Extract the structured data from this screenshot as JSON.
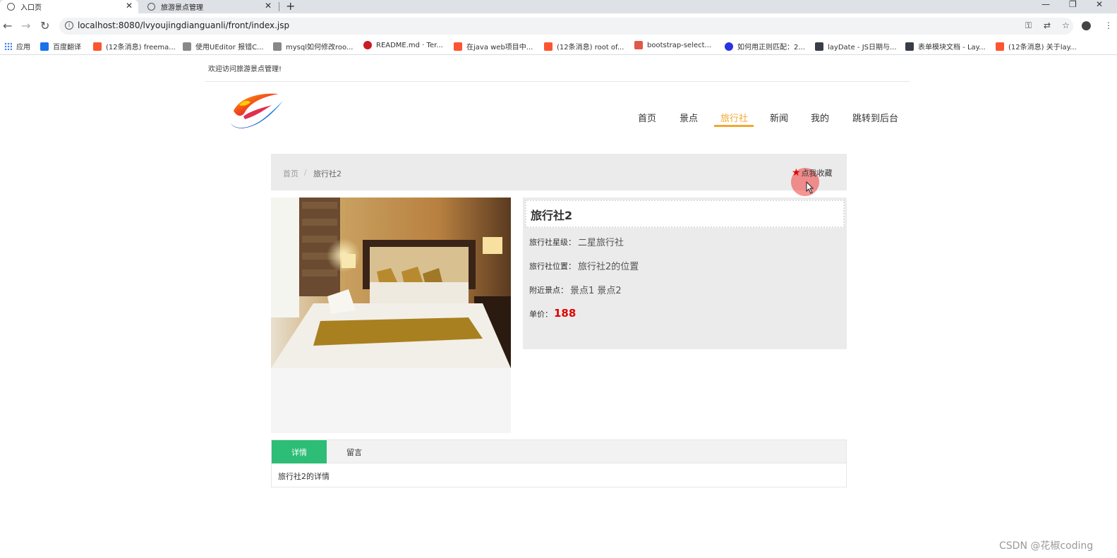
{
  "browser": {
    "tabs": [
      {
        "title": "入口页",
        "active": true
      },
      {
        "title": "旅游景点管理",
        "active": false
      }
    ],
    "url": "localhost:8080/lvyoujingdianguanli/front/index.jsp",
    "bookmarks": [
      {
        "label": "应用",
        "color": "#4285f4"
      },
      {
        "label": "百度翻译",
        "color": "#1a73e8"
      },
      {
        "label": "(12条消息) freema...",
        "color": "#fc5531"
      },
      {
        "label": "使用UEditor 报错C...",
        "color": "#555555"
      },
      {
        "label": "mysql如何修改roo...",
        "color": "#555555"
      },
      {
        "label": "README.md · Ter...",
        "color": "#c71d23"
      },
      {
        "label": "在java web项目中...",
        "color": "#fc5531"
      },
      {
        "label": "(12条消息) root of...",
        "color": "#fc5531"
      },
      {
        "label": "bootstrap-select...",
        "color": "#e0584a"
      },
      {
        "label": "如何用正则匹配：2...",
        "color": "#2932e1"
      },
      {
        "label": "layDate - JS日期与...",
        "color": "#393d49"
      },
      {
        "label": "表单模块文档 - Lay...",
        "color": "#393d49"
      },
      {
        "label": "(12条消息) 关于lay...",
        "color": "#fc5531"
      }
    ]
  },
  "header": {
    "welcome": "欢迎访问旅游景点管理!",
    "nav": [
      {
        "label": "首页",
        "active": false
      },
      {
        "label": "景点",
        "active": false
      },
      {
        "label": "旅行社",
        "active": true
      },
      {
        "label": "新闻",
        "active": false
      },
      {
        "label": "我的",
        "active": false
      },
      {
        "label": "跳转到后台",
        "active": false
      }
    ]
  },
  "breadcrumb": {
    "home": "首页",
    "separator": "/",
    "current": "旅行社2"
  },
  "favorite_label": "点我收藏",
  "detail": {
    "title": "旅行社2",
    "star_label": "旅行社星级：",
    "star_value": "二星旅行社",
    "location_label": "旅行社位置：",
    "location_value": "旅行社2的位置",
    "nearby_label": "附近景点：",
    "nearby_value": "景点1 景点2",
    "price_label": "单价：",
    "price_value": "188"
  },
  "tabs": {
    "detail_label": "详情",
    "message_label": "留言",
    "content": "旅行社2的详情"
  },
  "watermark": "CSDN @花椒coding",
  "colors": {
    "accent_nav": "#f0a830",
    "tab_active": "#2dbd76",
    "price": "#e10000"
  }
}
